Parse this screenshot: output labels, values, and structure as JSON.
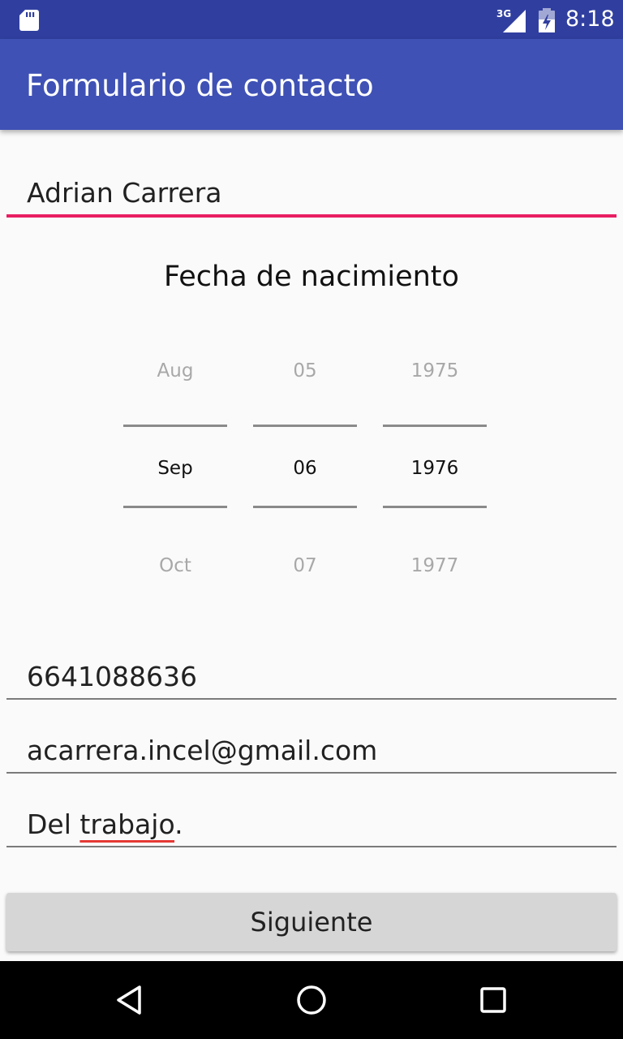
{
  "status_bar": {
    "network": "3G",
    "time": "8:18",
    "icons": [
      "sd-card-icon",
      "signal-icon",
      "battery-icon"
    ]
  },
  "app_bar": {
    "title": "Formulario de contacto"
  },
  "form": {
    "name": "Adrian Carrera",
    "date_label": "Fecha de nacimiento",
    "date_picker": {
      "month": {
        "prev": "Aug",
        "selected": "Sep",
        "next": "Oct"
      },
      "day": {
        "prev": "05",
        "selected": "06",
        "next": "07"
      },
      "year": {
        "prev": "1975",
        "selected": "1976",
        "next": "1977"
      }
    },
    "phone": "6641088636",
    "email": "acarrera.incel@gmail.com",
    "description_prefix": "Del ",
    "description_word": "trabajo",
    "description_suffix": "."
  },
  "actions": {
    "next_label": "Siguiente"
  },
  "nav_bar": {
    "icons": [
      "back-icon",
      "home-icon",
      "recents-icon"
    ]
  },
  "colors": {
    "status_bar": "#303f9f",
    "app_bar": "#3f51b5",
    "accent": "#e91e63"
  }
}
